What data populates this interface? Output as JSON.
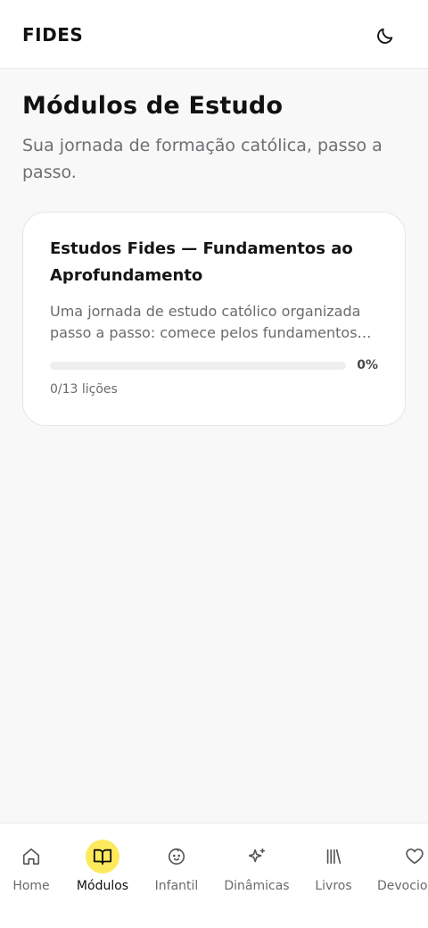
{
  "header": {
    "brand": "FIDES",
    "theme_icon": "moon-icon"
  },
  "page": {
    "title": "Módulos de Estudo",
    "subtitle": "Sua jornada de formação católica, passo a passo."
  },
  "modules": [
    {
      "title": "Estudos Fides — Fundamentos ao Aprofundamento",
      "description": "Uma jornada de estudo católico organizada passo a passo: comece pelos fundamentos d...",
      "progress_fraction": 0,
      "progress_label": "0%",
      "lessons_label": "0/13 lições"
    }
  ],
  "nav": {
    "items": [
      {
        "label": "Home",
        "icon": "home-icon",
        "active": false
      },
      {
        "label": "Módulos",
        "icon": "open-book-icon",
        "active": true
      },
      {
        "label": "Infantil",
        "icon": "baby-face-icon",
        "active": false
      },
      {
        "label": "Dinâmicas",
        "icon": "sparkles-icon",
        "active": false
      },
      {
        "label": "Livros",
        "icon": "library-icon",
        "active": false
      },
      {
        "label": "Devocio",
        "icon": "heart-icon",
        "active": false
      }
    ],
    "accent_color": "#fdea5c"
  }
}
